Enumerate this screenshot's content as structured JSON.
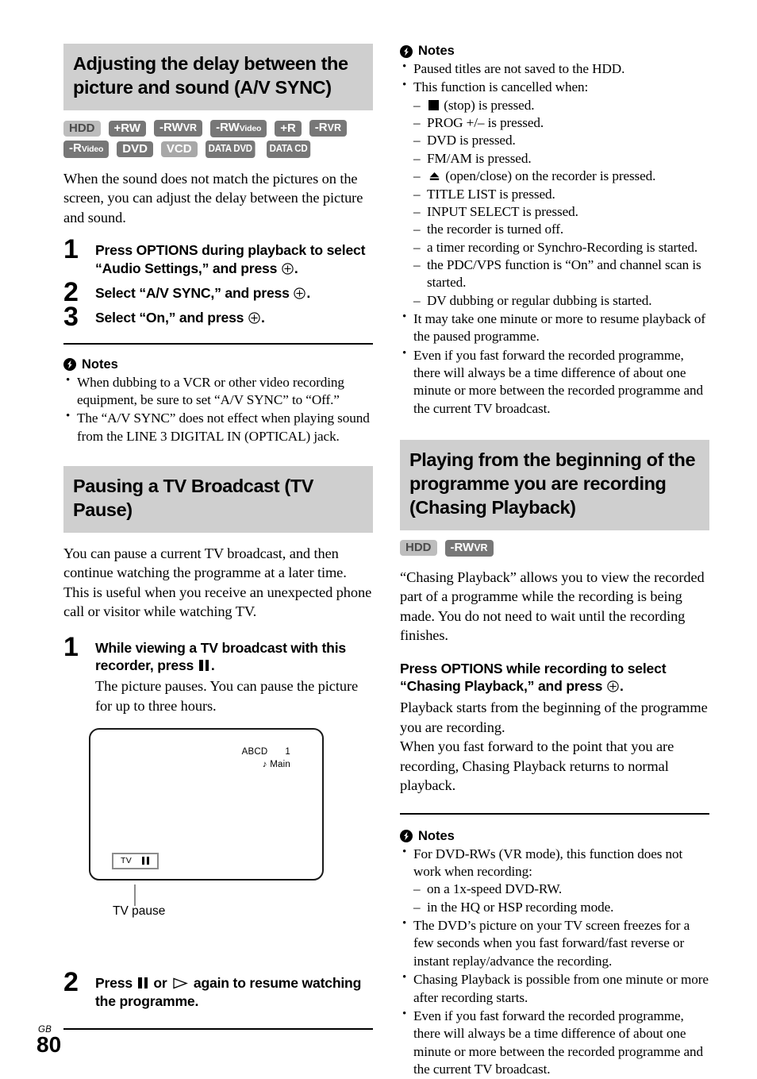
{
  "left_column": {
    "section1": {
      "heading": "Adjusting the delay between the picture and sound (A/V SYNC)",
      "badges_row1": [
        {
          "label": "HDD",
          "style": "light"
        },
        {
          "label": "+RW",
          "style": "dark"
        },
        {
          "label": "-RWVR",
          "style": "dark"
        },
        {
          "label": "-RWVideo",
          "style": "dark"
        },
        {
          "label": "+R",
          "style": "dark"
        },
        {
          "label": "-RVR",
          "style": "dark"
        }
      ],
      "badges_row2": [
        {
          "label": "-RVideo",
          "style": "dark"
        },
        {
          "label": "DVD",
          "style": "dark"
        },
        {
          "label": "VCD",
          "style": "vcd"
        },
        {
          "label": "DATA DVD",
          "style": "data"
        },
        {
          "label": "DATA CD",
          "style": "data"
        }
      ],
      "intro": "When the sound does not match the pictures on the screen, you can adjust the delay between the picture and sound.",
      "steps": [
        {
          "num": "1",
          "text_a": "Press OPTIONS during playback to select “Audio Settings,” and press ",
          "text_b": "."
        },
        {
          "num": "2",
          "text_a": "Select “A/V SYNC,” and press ",
          "text_b": "."
        },
        {
          "num": "3",
          "text_a": "Select “On,” and press ",
          "text_b": "."
        }
      ],
      "notes_heading": "Notes",
      "notes": [
        "When dubbing to a VCR or other video recording equipment, be sure to set “A/V SYNC” to “Off.”",
        "The “A/V SYNC” does not effect when playing sound from the LINE 3 DIGITAL IN (OPTICAL) jack."
      ]
    },
    "section2": {
      "heading": "Pausing a TV Broadcast (TV Pause)",
      "intro": "You can pause a current TV broadcast, and then continue watching the programme at a later time. This is useful when you receive an unexpected phone call or visitor while watching TV.",
      "step1": {
        "num": "1",
        "text_a": "While viewing a TV broadcast with this recorder, press ",
        "text_b": ".",
        "sub": "The picture pauses. You can pause the picture for up to three hours."
      },
      "figure": {
        "osd_channel_name": "ABCD",
        "osd_channel_number": "1",
        "osd_audio": "Main",
        "badge_label": "TV",
        "caption": "TV pause"
      },
      "step2": {
        "num": "2",
        "text_a": "Press ",
        "text_b": " or ",
        "text_c": " again to resume watching the programme."
      }
    }
  },
  "right_column": {
    "notes_top": {
      "heading": "Notes",
      "items": [
        {
          "text": "Paused titles are not saved to the HDD."
        },
        {
          "text": "This function is cancelled when:",
          "sub": [
            {
              "pre": "",
              "icon": "stop",
              "post": " (stop) is pressed."
            },
            {
              "pre": "PROG +/– is pressed.",
              "icon": "",
              "post": ""
            },
            {
              "pre": "DVD is pressed.",
              "icon": "",
              "post": ""
            },
            {
              "pre": "FM/AM is pressed.",
              "icon": "",
              "post": ""
            },
            {
              "pre": "",
              "icon": "eject",
              "post": " (open/close) on the recorder is pressed."
            },
            {
              "pre": "TITLE LIST is pressed.",
              "icon": "",
              "post": ""
            },
            {
              "pre": "INPUT SELECT is pressed.",
              "icon": "",
              "post": ""
            },
            {
              "pre": "the recorder is turned off.",
              "icon": "",
              "post": ""
            },
            {
              "pre": "a timer recording or Synchro-Recording is started.",
              "icon": "",
              "post": ""
            },
            {
              "pre": "the PDC/VPS function is “On” and channel scan is started.",
              "icon": "",
              "post": ""
            },
            {
              "pre": "DV dubbing or regular dubbing is started.",
              "icon": "",
              "post": ""
            }
          ]
        },
        {
          "text": "It may take one minute or more to resume playback of the paused programme."
        },
        {
          "text": "Even if you fast forward the recorded programme, there will always be a time difference of about one minute or more between the recorded programme and the current TV broadcast."
        }
      ]
    },
    "section3": {
      "heading": "Playing from the beginning of the programme you are recording (Chasing Playback)",
      "badges": [
        {
          "label": "HDD",
          "style": "light"
        },
        {
          "label": "-RWVR",
          "style": "dark"
        }
      ],
      "intro": "“Chasing Playback” allows you to view the recorded part of a programme while the recording is being made. You do not need to wait until the recording finishes.",
      "instruction_a": "Press OPTIONS while recording to select “Chasing Playback,” and press ",
      "instruction_b": ".",
      "body1": "Playback starts from the beginning of the programme you are recording.",
      "body2": "When you fast forward to the point that you are recording, Chasing Playback returns to normal playback.",
      "notes_heading": "Notes",
      "notes": [
        {
          "text": "For DVD-RWs (VR mode), this function does not work when recording:",
          "sub": [
            "on a 1x-speed DVD-RW.",
            "in the HQ or HSP recording mode."
          ]
        },
        {
          "text": "The DVD’s picture on your TV screen freezes for a few seconds when you fast forward/fast reverse or instant replay/advance the recording."
        },
        {
          "text": "Chasing Playback is possible from one minute or more after recording starts."
        },
        {
          "text": "Even if you fast forward the recorded programme, there will always be a time difference of about one minute or more between the recorded programme and the current TV broadcast."
        }
      ]
    }
  },
  "footer": {
    "region": "GB",
    "page_number": "80"
  },
  "colors": {
    "banner_bg": "#cfcfcf",
    "badge_dark": "#777777",
    "badge_light": "#bdbdbd",
    "badge_vcd": "#a8a8a8",
    "text": "#000000"
  }
}
